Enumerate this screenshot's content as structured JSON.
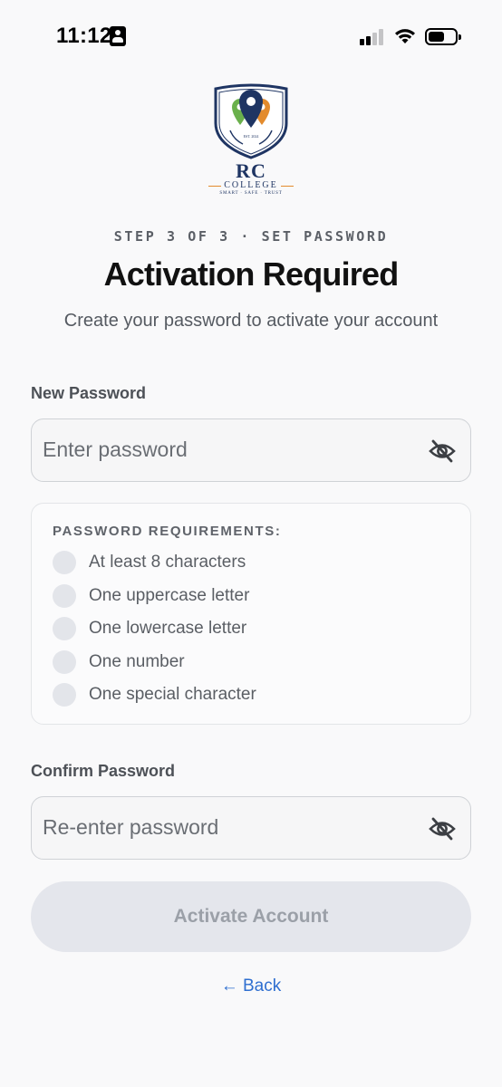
{
  "status_bar": {
    "time": "11:12",
    "icons": [
      "contact-badge-icon",
      "cellular-signal-icon",
      "wifi-icon",
      "battery-icon"
    ]
  },
  "logo": {
    "name": "RC",
    "subtitle": "COLLEGE",
    "tagline": "SMART · SAFE · TRUST",
    "est": "EST. 2024"
  },
  "step_label": "STEP 3 OF 3 · SET PASSWORD",
  "title": "Activation Required",
  "subtitle": "Create your password to activate your account",
  "new_password": {
    "label": "New Password",
    "placeholder": "Enter password",
    "value": "",
    "icon": "eye-off-icon"
  },
  "requirements": {
    "title": "PASSWORD REQUIREMENTS:",
    "items": [
      {
        "text": "At least 8 characters",
        "met": false
      },
      {
        "text": "One uppercase letter",
        "met": false
      },
      {
        "text": "One lowercase letter",
        "met": false
      },
      {
        "text": "One number",
        "met": false
      },
      {
        "text": "One special character",
        "met": false
      }
    ]
  },
  "confirm_password": {
    "label": "Confirm Password",
    "placeholder": "Re-enter password",
    "value": "",
    "icon": "eye-off-icon"
  },
  "activate_button": {
    "label": "Activate Account",
    "enabled": false
  },
  "back_link": {
    "label": "← Back"
  },
  "colors": {
    "background": "#f9f9fa",
    "accent_link": "#2f6fd0",
    "button_disabled_bg": "#e4e6ec",
    "button_disabled_text": "#9ba0a8",
    "logo_navy": "#1f3563",
    "logo_green": "#6ab04c",
    "logo_orange": "#e38b2d"
  }
}
